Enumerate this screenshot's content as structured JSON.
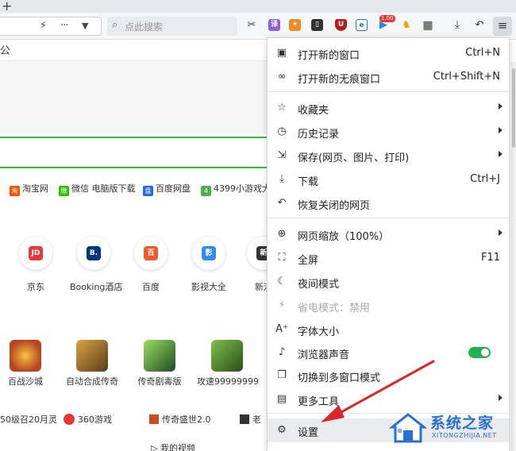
{
  "tabstrip": {
    "new_tab": "+"
  },
  "toolbar": {
    "search_placeholder": "点此搜索",
    "badge_count": "1.00"
  },
  "page": {
    "title_fragment": "公",
    "quick_links": [
      {
        "label": "淘宝网",
        "color": "#ff5000"
      },
      {
        "label": "微信 电脑版下载",
        "color": "#2dc100"
      },
      {
        "label": "百度网盘",
        "color": "#2468f2"
      },
      {
        "label": "4399小游戏大",
        "color": "#4caf50"
      }
    ],
    "sites": [
      {
        "label": "京东",
        "logo": "JD",
        "color": "#e4393c"
      },
      {
        "label": "Booking酒店",
        "logo": "B.",
        "color": "#003580"
      },
      {
        "label": "百度",
        "logo": "百",
        "color": "#f05a28"
      },
      {
        "label": "影视大全",
        "logo": "影",
        "color": "#2f8cf0"
      },
      {
        "label": "新浪",
        "logo": "新",
        "color": "#333333"
      }
    ],
    "games": [
      {
        "label": "百战沙城",
        "color": "#b5471f"
      },
      {
        "label": "自动合成传奇",
        "color": "#8a5a2a"
      },
      {
        "label": "传奇剧毒版",
        "color": "#2e6b3a"
      },
      {
        "label": "攻速99999999",
        "color": "#3e7a2f"
      }
    ],
    "bottom_row": [
      "50级召20月灵",
      "360游戏",
      "传奇盛世2.0",
      "老"
    ],
    "footer_fragment": "我的视频"
  },
  "menu": {
    "items": [
      {
        "icon": "window-icon",
        "glyph": "▣",
        "label": "打开新的窗口",
        "shortcut": "Ctrl+N"
      },
      {
        "icon": "incognito-icon",
        "glyph": "∞",
        "label": "打开新的无痕窗口",
        "shortcut": "Ctrl+Shift+N"
      },
      {
        "icon": "star-icon",
        "glyph": "☆",
        "label": "收藏夹",
        "submenu": true
      },
      {
        "icon": "history-icon",
        "glyph": "◷",
        "label": "历史记录",
        "submenu": true
      },
      {
        "icon": "save-icon",
        "glyph": "⇲",
        "label": "保存(网页、图片、打印)",
        "submenu": true
      },
      {
        "icon": "download-icon",
        "glyph": "⤓",
        "label": "下载",
        "shortcut": "Ctrl+J"
      },
      {
        "icon": "restore-icon",
        "glyph": "↶",
        "label": "恢复关闭的网页"
      },
      {
        "icon": "zoom-icon",
        "glyph": "⊕",
        "label": "网页缩放（100%）",
        "submenu": true
      },
      {
        "icon": "fullscreen-icon",
        "glyph": "⛶",
        "label": "全屏",
        "shortcut": "F11"
      },
      {
        "icon": "moon-icon",
        "glyph": "☾",
        "label": "夜间模式"
      },
      {
        "icon": "plug-icon",
        "glyph": "⚡",
        "label": "省电模式：禁用",
        "disabled": true
      },
      {
        "icon": "font-size-icon",
        "glyph": "A⁺",
        "label": "字体大小"
      },
      {
        "icon": "speaker-icon",
        "glyph": "♪",
        "label": "浏览器声音",
        "toggle": true
      },
      {
        "icon": "multi-window-icon",
        "glyph": "❐",
        "label": "切换到多窗口模式"
      },
      {
        "icon": "toolbox-icon",
        "glyph": "▤",
        "label": "更多工具",
        "submenu": true
      },
      {
        "icon": "gear-icon",
        "glyph": "⚙",
        "label": "设置"
      }
    ],
    "toggle_on": true
  },
  "watermark": {
    "title": "系统之家",
    "url": "XITONGZHIJIA.NET"
  },
  "colors": {
    "accent_green": "#24b14c",
    "search_border": "#3cb34a",
    "arrow_red": "#d9262b",
    "watermark_blue": "#2a6fd6"
  }
}
